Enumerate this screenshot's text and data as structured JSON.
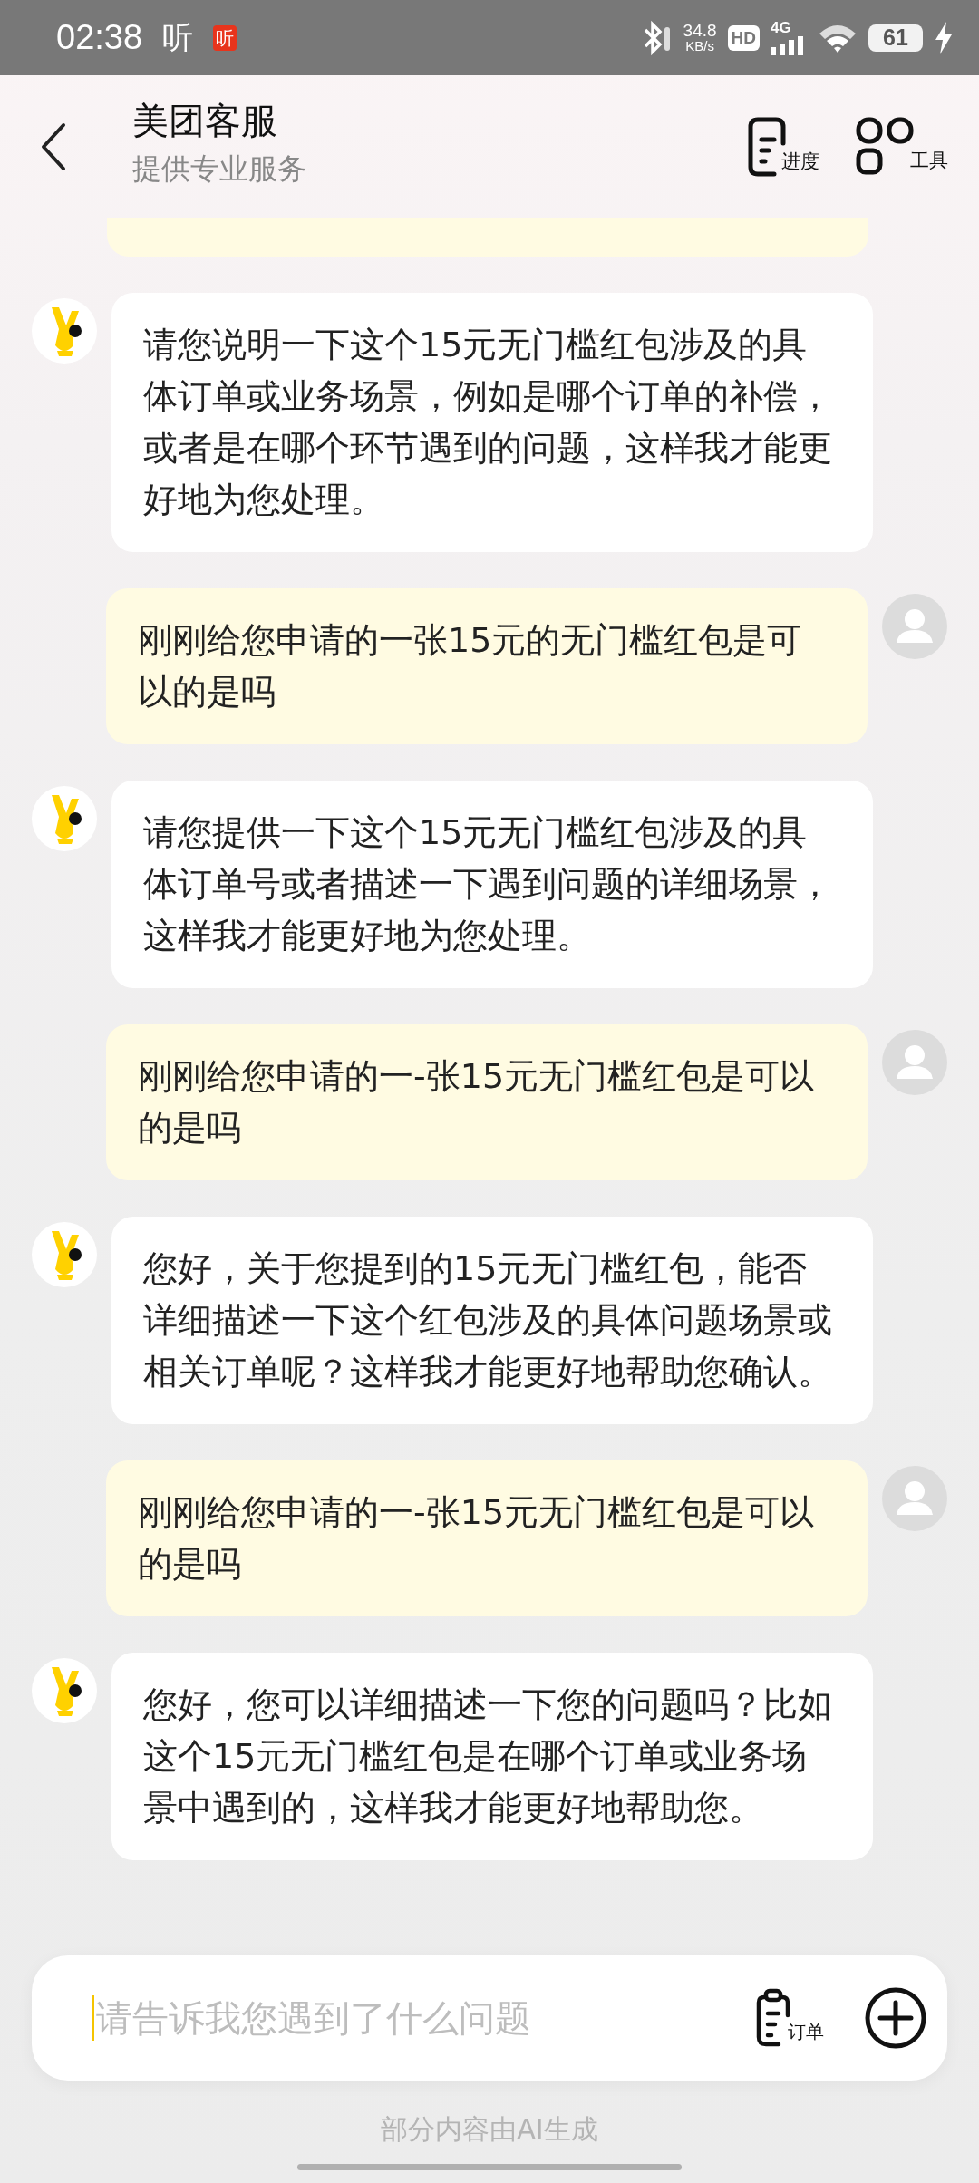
{
  "status_bar": {
    "time": "02:38",
    "notifications": [
      {
        "kind": "glyph",
        "label": "听"
      },
      {
        "kind": "badge",
        "label": "听"
      }
    ],
    "net_speed": "34.8",
    "net_unit": "KB/s",
    "hd": "HD",
    "network": "4G",
    "battery": "61",
    "charging": true
  },
  "header": {
    "title": "美团客服",
    "subtitle": "提供专业服务",
    "actions": [
      {
        "kind": "progress",
        "label": "进度"
      },
      {
        "kind": "tools",
        "label": "工具"
      }
    ]
  },
  "messages": [
    {
      "kind": "user",
      "cut": true
    },
    {
      "kind": "bot",
      "text": "请您说明一下这个15元无门槛红包涉及的具体订单或业务场景，例如是哪个订单的补偿，或者是在哪个环节遇到的问题，这样我才能更好地为您处理。"
    },
    {
      "kind": "user",
      "text": "刚刚给您申请的一张15元的无门槛红包是可以的是吗"
    },
    {
      "kind": "bot",
      "text": "请您提供一下这个15元无门槛红包涉及的具体订单号或者描述一下遇到问题的详细场景，这样我才能更好地为您处理。"
    },
    {
      "kind": "user",
      "text": "刚刚给您申请的一-张15元无门槛红包是可以的是吗"
    },
    {
      "kind": "bot",
      "text": "您好，关于您提到的15元无门槛红包，能否详细描述一下这个红包涉及的具体问题场景或相关订单呢？这样我才能更好地帮助您确认。"
    },
    {
      "kind": "user",
      "text": "刚刚给您申请的一-张15元无门槛红包是可以的是吗"
    },
    {
      "kind": "bot",
      "text": "您好，您可以详细描述一下您的问题吗？比如这个15元无门槛红包是在哪个订单或业务场景中遇到的，这样我才能更好地帮助您。"
    }
  ],
  "input": {
    "placeholder": "请告诉我您遇到了什么问题",
    "order_label": "订单"
  },
  "footer": "部分内容由AI生成"
}
